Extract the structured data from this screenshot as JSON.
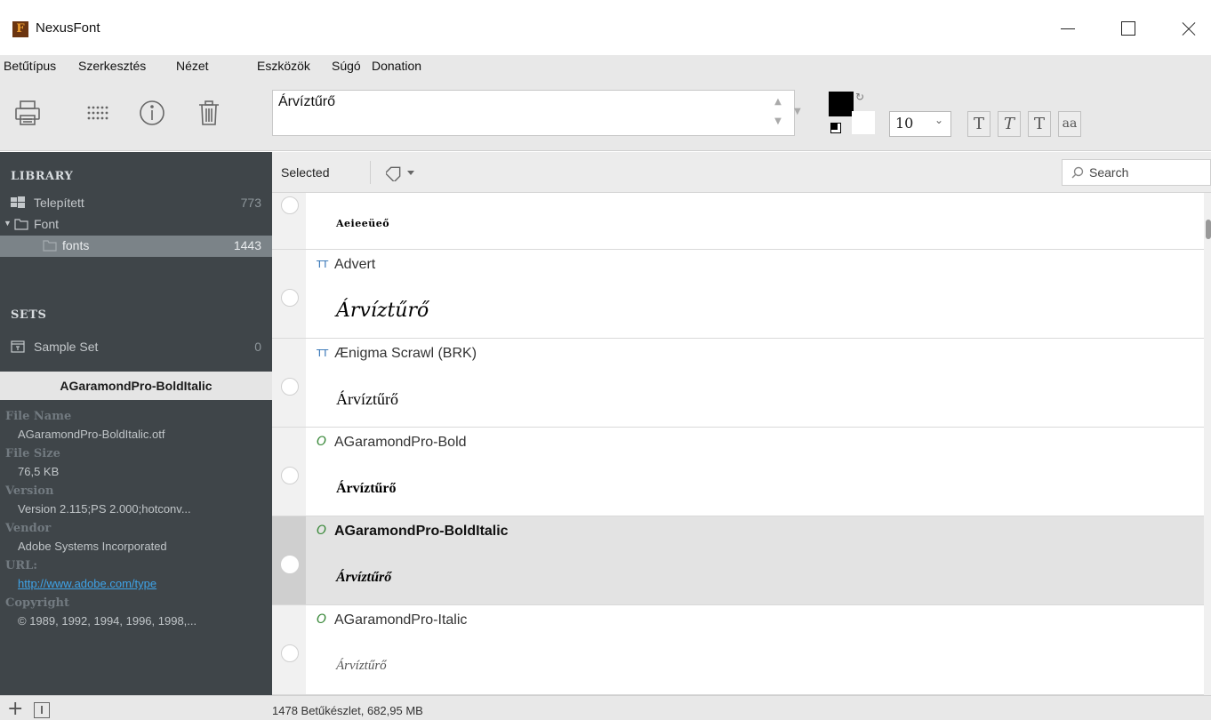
{
  "window": {
    "title": "NexusFont",
    "logo_letter": "F"
  },
  "menu": [
    {
      "label": "Betűtípus"
    },
    {
      "label": "Szerkesztés"
    },
    {
      "label": "Nézet"
    },
    {
      "label": "Eszközök"
    },
    {
      "label": "Súgó"
    },
    {
      "label": "Donation"
    }
  ],
  "toolbar": {
    "sample_text": "Árvíztűrő",
    "font_size": "10",
    "foreground_color": "#000000",
    "background_color": "#ffffff",
    "style_buttons": [
      "T",
      "T",
      "T",
      "aa"
    ]
  },
  "sidebar": {
    "library_heading": "LIBRARY",
    "library_items": [
      {
        "label": "Telepített",
        "count": "773"
      },
      {
        "label": "Font",
        "count": ""
      },
      {
        "label": "fonts",
        "count": "1443"
      }
    ],
    "sets_heading": "SETS",
    "sets_items": [
      {
        "label": "Sample Set",
        "count": "0"
      }
    ]
  },
  "info": {
    "title": "AGaramondPro-BoldItalic",
    "fields": [
      {
        "key": "File Name",
        "value": "AGaramondPro-BoldItalic.otf"
      },
      {
        "key": "File Size",
        "value": "76,5 KB"
      },
      {
        "key": "Version",
        "value": "Version 2.115;PS 2.000;hotconv..."
      },
      {
        "key": "Vendor",
        "value": "Adobe Systems Incorporated"
      },
      {
        "key": "URL:",
        "value": "http://www.adobe.com/type"
      },
      {
        "key": "Copyright",
        "value": "© 1989, 1992, 1994, 1996, 1998,..."
      }
    ]
  },
  "content_bar": {
    "selected_label": "Selected",
    "search_placeholder": "Search"
  },
  "fonts": [
    {
      "name": "",
      "sample": "Aeieeüeő",
      "type": ""
    },
    {
      "name": "Advert",
      "sample": "Árvíztűrő",
      "type": "TT"
    },
    {
      "name": "Ænigma Scrawl (BRK)",
      "sample": "Árvíztűrő",
      "type": "TT"
    },
    {
      "name": "AGaramondPro-Bold",
      "sample": "Árvíztűrő",
      "type": "O"
    },
    {
      "name": "AGaramondPro-BoldItalic",
      "sample": "Árvíztűrő",
      "type": "O"
    },
    {
      "name": "AGaramondPro-Italic",
      "sample": "Árvíztűrő",
      "type": "O"
    }
  ],
  "status": {
    "text": "1478 Betűkészlet, 682,95 MB"
  }
}
